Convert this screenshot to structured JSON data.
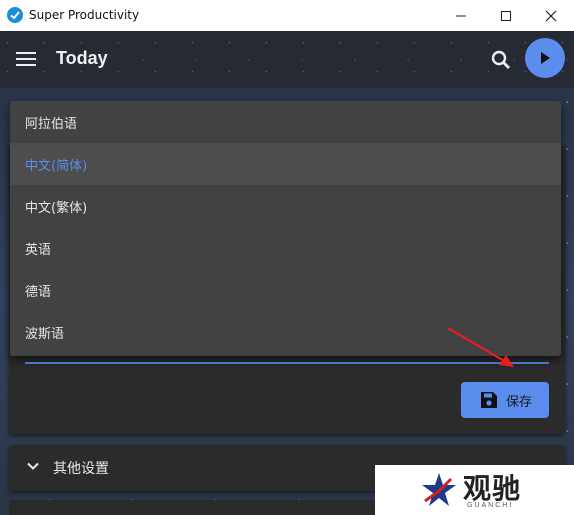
{
  "window": {
    "title": "Super Productivity",
    "minimize_icon": "minimize-icon",
    "maximize_icon": "maximize-icon",
    "close_icon": "close-icon"
  },
  "toolbar": {
    "menu_icon": "hamburger-menu-icon",
    "title": "Today",
    "search_icon": "search-icon",
    "play_icon": "play-icon"
  },
  "language_dropdown": {
    "options": [
      {
        "label": "阿拉伯语",
        "selected": false
      },
      {
        "label": "中文(简体)",
        "selected": true
      },
      {
        "label": "中文(繁体)",
        "selected": false
      },
      {
        "label": "英语",
        "selected": false
      },
      {
        "label": "德语",
        "selected": false
      },
      {
        "label": "波斯语",
        "selected": false
      }
    ]
  },
  "settings_card": {
    "save_label": "保存",
    "save_icon": "save-disk-icon"
  },
  "other_settings": {
    "label": "其他设置",
    "chevron_icon": "chevron-down-icon"
  },
  "watermark": {
    "text": "观驰",
    "subtext": "GUANCHI"
  },
  "colors": {
    "accent": "#5b8dee",
    "panel": "#424242",
    "card": "#2b2b2b",
    "annotation_arrow": "#e02020"
  }
}
